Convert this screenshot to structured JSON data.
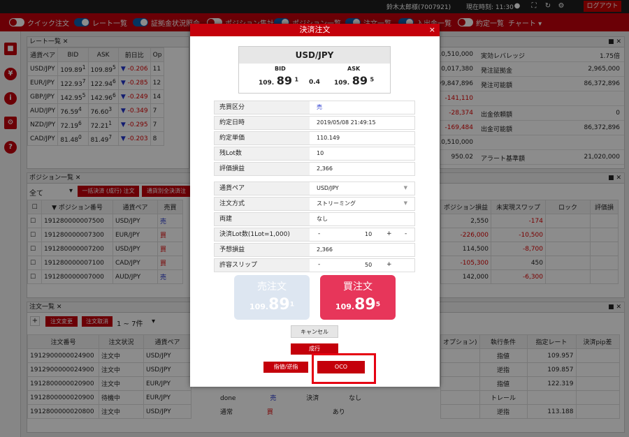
{
  "topbar": {
    "user": "鈴木太郎様(7007921)",
    "time": "現在時刻: 11:30",
    "logout": "ログアウト"
  },
  "toolbar": {
    "items": [
      "クイック注文",
      "レート一覧",
      "証拠金状況照会",
      "ポジション集計",
      "ポジション一覧",
      "注文一覧",
      "入出金一覧",
      "約定一覧"
    ],
    "chart": "チャート ▾"
  },
  "rate_panel": {
    "title": "レート一覧",
    "headers": [
      "通貨ペア",
      "BID",
      "ASK",
      "前日比",
      "Op"
    ],
    "rows": [
      {
        "pair": "USD/JPY",
        "bid_main": "109.89",
        "bid_sup": "1",
        "ask_main": "109.89",
        "ask_sup": "5",
        "change": "-0.206",
        "op": "11"
      },
      {
        "pair": "EUR/JPY",
        "bid_main": "122.93",
        "bid_sup": "7",
        "ask_main": "122.94",
        "ask_sup": "6",
        "change": "-0.285",
        "op": "12"
      },
      {
        "pair": "GBP/JPY",
        "bid_main": "142.95",
        "bid_sup": "5",
        "ask_main": "142.96",
        "ask_sup": "6",
        "change": "-0.249",
        "op": "14"
      },
      {
        "pair": "AUD/JPY",
        "bid_main": "76.59",
        "bid_sup": "4",
        "ask_main": "76.60",
        "ask_sup": "3",
        "change": "-0.349",
        "op": "7"
      },
      {
        "pair": "NZD/JPY",
        "bid_main": "72.19",
        "bid_sup": "6",
        "ask_main": "72.21",
        "ask_sup": "1",
        "change": "-0.295",
        "op": "7"
      },
      {
        "pair": "CAD/JPY",
        "bid_main": "81.48",
        "bid_sup": "0",
        "ask_main": "81.49",
        "ask_sup": "7",
        "change": "-0.203",
        "op": "8"
      }
    ]
  },
  "margin_panel": {
    "col_values": [
      "10,510,000",
      "0,017,380",
      "99,847,896",
      "-141,110",
      "-28,374",
      "-169,484",
      "10,510,000",
      "950.02"
    ],
    "labels": [
      "実効レバレッジ",
      "発注証拠金",
      "発注可能額",
      "",
      "出金依頼額",
      "出金可能額",
      "",
      "アラート基準額"
    ],
    "values": [
      "1.75倍",
      "2,965,000",
      "86,372,896",
      "",
      "0",
      "86,372,896",
      "",
      "21,020,000"
    ]
  },
  "position_panel": {
    "title": "ポジション一覧",
    "filter": "全て",
    "btn1": "一括決済 (成行) 注文",
    "btn2": "通貨別全決済注",
    "headers": [
      "▼ ポジション番号",
      "通貨ペア",
      "売買"
    ],
    "right_headers": [
      "ポジション損益",
      "未実現スワップ",
      "ロック",
      "評価損"
    ],
    "rows": [
      {
        "no": "191280000007500",
        "pair": "USD/JPY",
        "side": "売",
        "pl": "2,550",
        "swap": "-174"
      },
      {
        "no": "191280000007300",
        "pair": "EUR/JPY",
        "side": "買",
        "pl": "-226,000",
        "swap": "-10,500"
      },
      {
        "no": "191280000007200",
        "pair": "USD/JPY",
        "side": "買",
        "pl": "114,500",
        "swap": "-8,700"
      },
      {
        "no": "191280000007100",
        "pair": "CAD/JPY",
        "side": "買",
        "pl": "-105,300",
        "swap": "450"
      },
      {
        "no": "191280000007000",
        "pair": "AUD/JPY",
        "side": "売",
        "pl": "142,000",
        "swap": "-6,300"
      }
    ]
  },
  "order_panel": {
    "title": "注文一覧",
    "btn_add": "+",
    "btn_change": "注文変更",
    "btn_cancel": "注文取消",
    "range": "1 ~ 7件",
    "headers": [
      "注文番号",
      "注文状況",
      "通貨ペア"
    ],
    "right_headers": [
      "オプション)",
      "執行条件",
      "指定レート",
      "決済pip差"
    ],
    "rows": [
      {
        "no": "1912900000024900",
        "status": "注文中",
        "pair": "USD/JPY",
        "cond": "指値",
        "rate": "109.957"
      },
      {
        "no": "1912900000024900",
        "status": "注文中",
        "pair": "USD/JPY",
        "cond": "逆指",
        "rate": "109.857"
      },
      {
        "no": "1912800000020900",
        "status": "注文中",
        "pair": "EUR/JPY",
        "cond": "指値",
        "rate": "122.319"
      },
      {
        "no": "1912800000020900",
        "status": "待機中",
        "pair": "EUR/JPY",
        "cond": "トレール",
        "rate": ""
      },
      {
        "no": "1912800000020800",
        "status": "注文中",
        "pair": "USD/JPY",
        "cond": "逆指",
        "rate": "113.188"
      }
    ],
    "mid_row4": [
      "done",
      "売",
      "決済",
      "なし"
    ],
    "mid_row5": [
      "通常",
      "買",
      "あり"
    ]
  },
  "modal": {
    "title": "決済注文",
    "close": "×",
    "pair": "USD/JPY",
    "bid_label": "BID",
    "ask_label": "ASK",
    "bid_small": "109.",
    "bid_big": "89",
    "bid_sup": "1",
    "spread": "0.4",
    "ask_small": "109.",
    "ask_big": "89",
    "ask_sup": "5",
    "fields1": [
      {
        "label": "売買区分",
        "value": "売"
      },
      {
        "label": "約定日時",
        "value": "2019/05/08 21:49:15"
      },
      {
        "label": "約定単価",
        "value": "110.149"
      },
      {
        "label": "残Lot数",
        "value": "10"
      },
      {
        "label": "評価損益",
        "value": "2,366"
      }
    ],
    "fields2": [
      {
        "label": "通貨ペア",
        "value": "USD/JPY"
      },
      {
        "label": "注文方式",
        "value": "ストリーミング"
      },
      {
        "label": "両建",
        "value": "なし"
      },
      {
        "label": "決済Lot数(1Lot=1,000)",
        "value": "10"
      },
      {
        "label": "予想損益",
        "value": "2,366"
      },
      {
        "label": "許容スリップ",
        "value": "50"
      }
    ],
    "sell_title": "売注文",
    "buy_title": "買注文",
    "sell_small": "109.",
    "sell_big": "89",
    "sell_sup": "1",
    "buy_small": "109.",
    "buy_big": "89",
    "buy_sup": "5",
    "cancel": "キャンセル",
    "market": "成行",
    "limit": "指値/逆指",
    "oco": "OCO"
  },
  "colors": {
    "brand": "#c4000b",
    "sell_box": "#dde6f1",
    "buy_box": "#e7365a",
    "highlight": "#e50012"
  }
}
